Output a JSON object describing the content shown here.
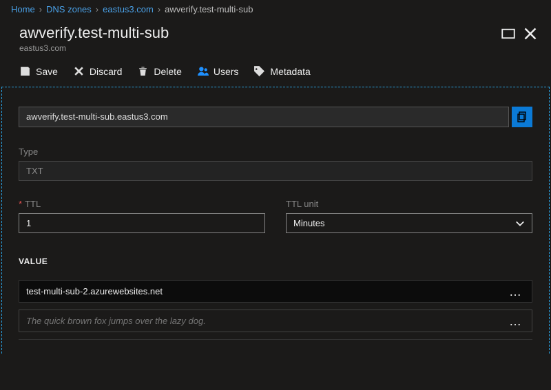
{
  "breadcrumb": {
    "home": "Home",
    "dns_zones": "DNS zones",
    "zone": "eastus3.com",
    "record": "awverify.test-multi-sub"
  },
  "header": {
    "title": "awverify.test-multi-sub",
    "subtitle": "eastus3.com"
  },
  "toolbar": {
    "save": "Save",
    "discard": "Discard",
    "delete": "Delete",
    "users": "Users",
    "metadata": "Metadata"
  },
  "fqdn": "awverify.test-multi-sub.eastus3.com",
  "type": {
    "label": "Type",
    "value": "TXT"
  },
  "ttl": {
    "label": "TTL",
    "value": "1"
  },
  "ttl_unit": {
    "label": "TTL unit",
    "value": "Minutes"
  },
  "values": {
    "header": "VALUE",
    "rows": [
      "test-multi-sub-2.azurewebsites.net"
    ],
    "placeholder": "The quick brown fox jumps over the lazy dog."
  }
}
